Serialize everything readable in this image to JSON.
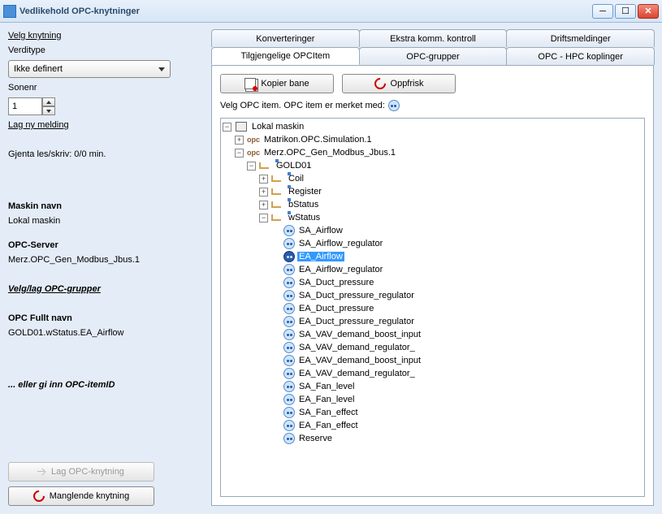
{
  "window": {
    "title": "Vedlikehold OPC-knytninger"
  },
  "sidebar": {
    "select_label": "Velg knytning",
    "value_type_label": "Verditype",
    "value_type_value": "Ikke definert",
    "zone_label": "Sonenr",
    "zone_value": "1",
    "new_msg": "Lag ny melding",
    "repeat": "Gjenta les/skriv: 0/0 min.",
    "machine_label": "Maskin navn",
    "machine_value": "Lokal maskin",
    "server_label": "OPC-Server",
    "server_value": "Merz.OPC_Gen_Modbus_Jbus.1",
    "groups_link": "Velg/lag OPC-grupper",
    "fullname_label": "OPC Fullt navn",
    "fullname_value": "GOLD01.wStatus.EA_Airflow",
    "or_enter": "... eller gi inn OPC-itemID",
    "create_btn": "Lag OPC-knytning",
    "missing_btn": "Manglende knytning"
  },
  "tabs": {
    "row1": [
      "Konverteringer",
      "Ekstra komm. kontroll",
      "Driftsmeldinger"
    ],
    "row2": [
      "Tilgjengelige OPCItem",
      "OPC-grupper",
      "OPC - HPC koplinger"
    ],
    "active": "Tilgjengelige OPCItem"
  },
  "toolbar": {
    "copy": "Kopier bane",
    "refresh": "Oppfrisk"
  },
  "instruction": "Velg OPC item. OPC item er merket med:",
  "tree": {
    "root": "Lokal maskin",
    "servers": [
      {
        "name": "Matrikon.OPC.Simulation.1",
        "expanded": false
      },
      {
        "name": "Merz.OPC_Gen_Modbus_Jbus.1",
        "expanded": true,
        "children": [
          {
            "name": "GOLD01",
            "expanded": true,
            "children": [
              {
                "name": "Coil",
                "expanded": false
              },
              {
                "name": "Register",
                "expanded": false
              },
              {
                "name": "bStatus",
                "expanded": false
              },
              {
                "name": "wStatus",
                "expanded": true,
                "items": [
                  "SA_Airflow",
                  "SA_Airflow_regulator",
                  "EA_Airflow",
                  "EA_Airflow_regulator",
                  "SA_Duct_pressure",
                  "SA_Duct_pressure_regulator",
                  "EA_Duct_pressure",
                  "EA_Duct_pressure_regulator",
                  "SA_VAV_demand_boost_input",
                  "SA_VAV_demand_regulator_",
                  "EA_VAV_demand_boost_input",
                  "EA_VAV_demand_regulator_",
                  "SA_Fan_level",
                  "EA_Fan_level",
                  "SA_Fan_effect",
                  "EA_Fan_effect",
                  "Reserve"
                ]
              }
            ]
          }
        ]
      }
    ],
    "selected": "EA_Airflow"
  }
}
